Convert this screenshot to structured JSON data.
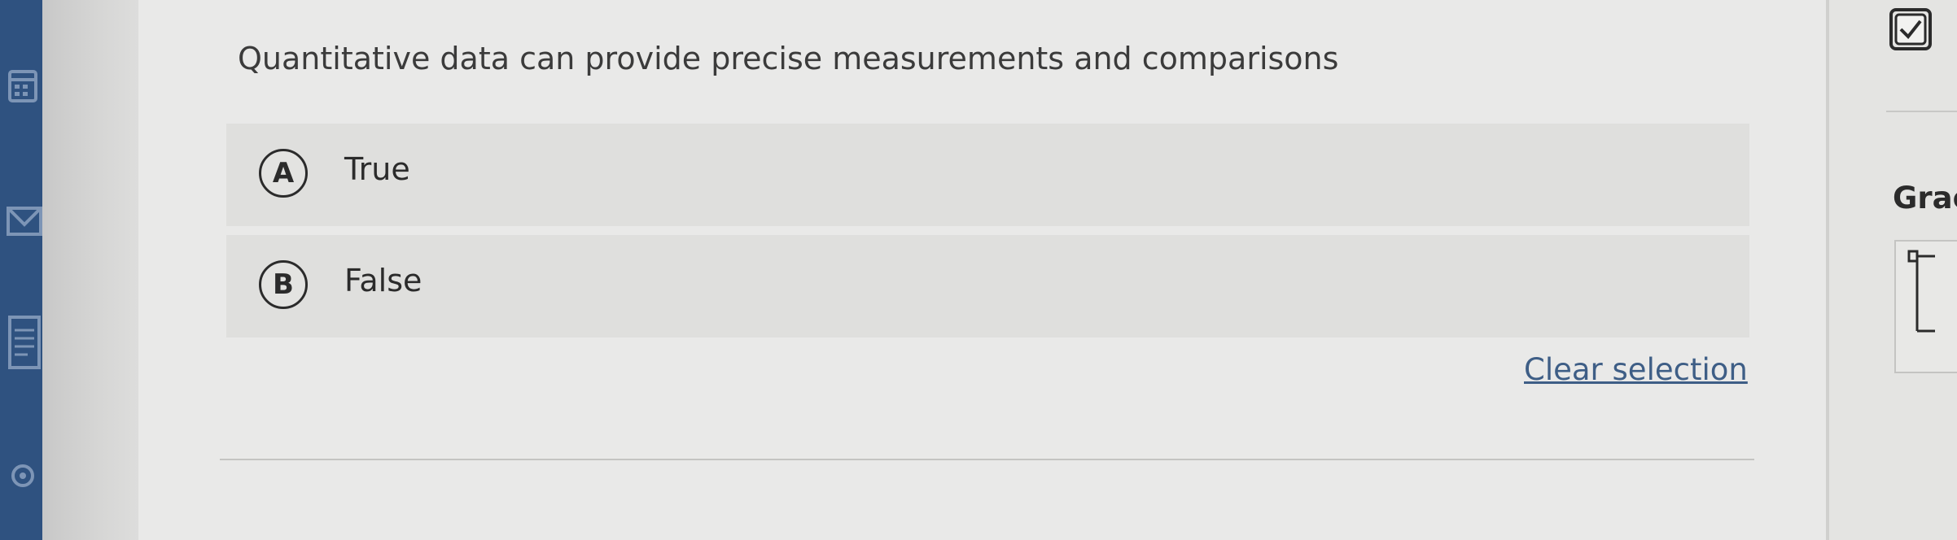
{
  "question": {
    "text": "Quantitative data can provide precise measurements and comparisons"
  },
  "options": [
    {
      "letter": "A",
      "label": "True"
    },
    {
      "letter": "B",
      "label": "False"
    }
  ],
  "clear_selection_label": "Clear selection",
  "right_panel": {
    "title_partial": "Grac"
  },
  "colors": {
    "sidebar": "#2f5280",
    "link": "#3e5e86",
    "text": "#2b2b2b",
    "option_bg": "#dfdfdd"
  },
  "icons": {
    "sidebar": [
      "calendar-icon",
      "mail-icon",
      "document-list-icon",
      "settings-icon"
    ],
    "right_panel": [
      "check-box-icon"
    ]
  }
}
